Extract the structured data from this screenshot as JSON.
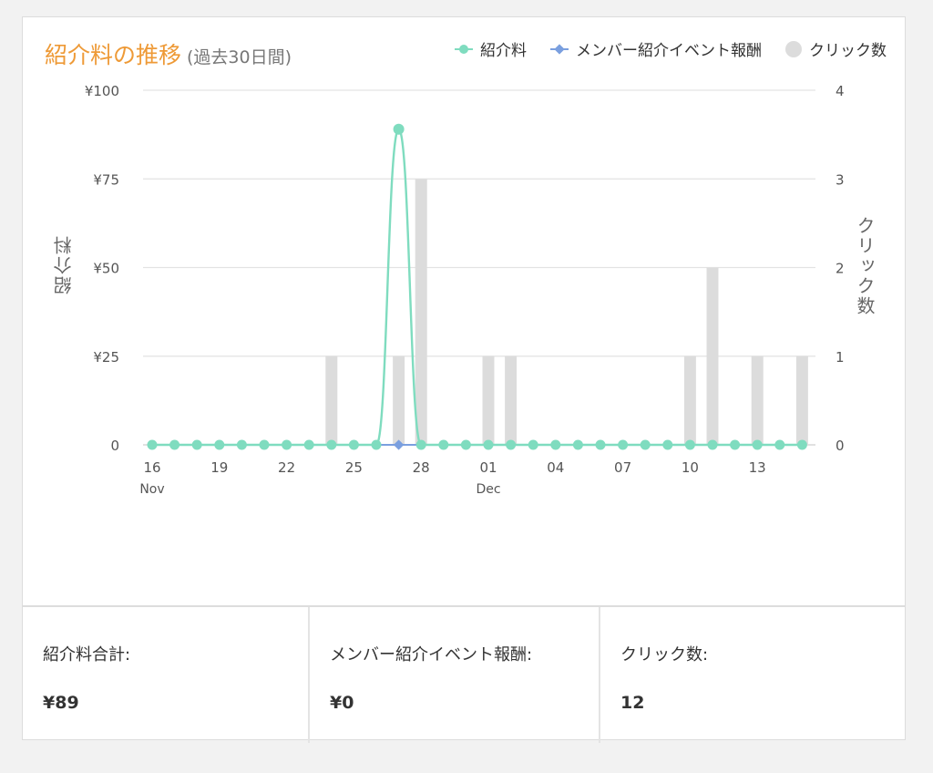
{
  "header": {
    "title": "紹介料の推移",
    "subtitle": "(過去30日間)"
  },
  "legend": [
    {
      "label": "紹介料",
      "color": "#7fdcbf",
      "icon": "line-dot-icon"
    },
    {
      "label": "メンバー紹介イベント報酬",
      "color": "#7a9fdf",
      "icon": "line-diamond-icon"
    },
    {
      "label": "クリック数",
      "color": "#dcdcdc",
      "icon": "circle-icon"
    }
  ],
  "summary": [
    {
      "label": "紹介料合計:",
      "value": "¥89"
    },
    {
      "label": "メンバー紹介イベント報酬:",
      "value": "¥0"
    },
    {
      "label": "クリック数:",
      "value": "12"
    }
  ],
  "chart_data": {
    "type": "bar+line",
    "x_tick_labels": [
      {
        "day": "16",
        "month": "Nov"
      },
      {
        "day": "19",
        "month": ""
      },
      {
        "day": "22",
        "month": ""
      },
      {
        "day": "25",
        "month": ""
      },
      {
        "day": "28",
        "month": ""
      },
      {
        "day": "01",
        "month": "Dec"
      },
      {
        "day": "04",
        "month": ""
      },
      {
        "day": "07",
        "month": ""
      },
      {
        "day": "10",
        "month": ""
      },
      {
        "day": "13",
        "month": ""
      }
    ],
    "x_dates": [
      "11-16",
      "11-17",
      "11-18",
      "11-19",
      "11-20",
      "11-21",
      "11-22",
      "11-23",
      "11-24",
      "11-25",
      "11-26",
      "11-27",
      "11-28",
      "11-29",
      "11-30",
      "12-01",
      "12-02",
      "12-03",
      "12-04",
      "12-05",
      "12-06",
      "12-07",
      "12-08",
      "12-09",
      "12-10",
      "12-11",
      "12-12",
      "12-13",
      "12-14",
      "12-15"
    ],
    "ylabel_left": "紹介料",
    "ylabel_right": "クリック数",
    "ylim_left": [
      0,
      100
    ],
    "ylim_right": [
      0,
      4
    ],
    "yticks_left": [
      "0",
      "¥25",
      "¥50",
      "¥75",
      "¥100"
    ],
    "yticks_right": [
      "0",
      "1",
      "2",
      "3",
      "4"
    ],
    "grid": true,
    "legend_position": "top-right",
    "series": [
      {
        "name": "紹介料",
        "kind": "line",
        "axis": "left",
        "color": "#7fdcbf",
        "values": [
          0,
          0,
          0,
          0,
          0,
          0,
          0,
          0,
          0,
          0,
          0,
          89,
          0,
          0,
          0,
          0,
          0,
          0,
          0,
          0,
          0,
          0,
          0,
          0,
          0,
          0,
          0,
          0,
          0,
          0
        ]
      },
      {
        "name": "メンバー紹介イベント報酬",
        "kind": "line",
        "axis": "left",
        "color": "#7a9fdf",
        "values": [
          0,
          0,
          0,
          0,
          0,
          0,
          0,
          0,
          0,
          0,
          0,
          0,
          0,
          0,
          0,
          0,
          0,
          0,
          0,
          0,
          0,
          0,
          0,
          0,
          0,
          0,
          0,
          0,
          0,
          0
        ]
      },
      {
        "name": "クリック数",
        "kind": "bar",
        "axis": "right",
        "color": "#dcdcdc",
        "values": [
          0,
          0,
          0,
          0,
          0,
          0,
          0,
          0,
          1,
          0,
          0,
          1,
          3,
          0,
          0,
          1,
          1,
          0,
          0,
          0,
          0,
          0,
          0,
          0,
          1,
          2,
          0,
          1,
          0,
          1
        ]
      }
    ]
  }
}
